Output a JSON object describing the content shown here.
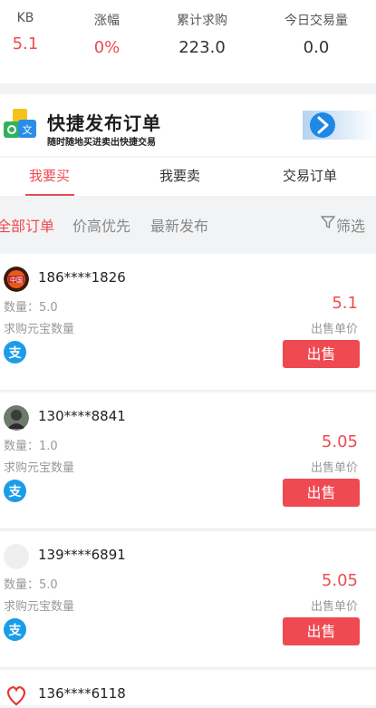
{
  "stats": [
    {
      "label": "KB",
      "value": "5.1"
    },
    {
      "label": "涨幅",
      "value": "0%"
    },
    {
      "label": "累计求购",
      "value": "223.0"
    },
    {
      "label": "今日交易量",
      "value": "0.0"
    }
  ],
  "banner": {
    "title": "快捷发布订单",
    "subtitle": "随时随地买进卖出快捷交易"
  },
  "tabs": [
    "我要买",
    "我要卖",
    "交易订单"
  ],
  "filters": [
    "全部订单",
    "价高优先",
    "最新发布"
  ],
  "filter_button": "筛选",
  "orders": [
    {
      "user": "186****1826",
      "qty": "数量：5.0",
      "qty_label": "求购元宝数量",
      "price": "5.1",
      "price_label": "出售单价",
      "action": "出售"
    },
    {
      "user": "130****8841",
      "qty": "数量：1.0",
      "qty_label": "求购元宝数量",
      "price": "5.05",
      "price_label": "出售单价",
      "action": "出售"
    },
    {
      "user": "139****6891",
      "qty": "数量：5.0",
      "qty_label": "求购元宝数量",
      "price": "5.05",
      "price_label": "出售单价",
      "action": "出售"
    },
    {
      "user": "136****6118"
    }
  ],
  "colors": {
    "accent": "#ef4a52",
    "alipay": "#1a9de8",
    "background": "#f2f3f5"
  }
}
